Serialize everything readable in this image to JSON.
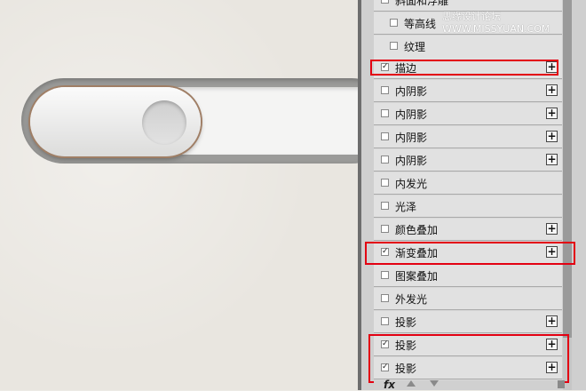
{
  "watermark": "思缘设计论坛 WWW.MISSYUAN.COM",
  "styles": [
    {
      "label": "斜面和浮雕",
      "checked": false,
      "plus": false,
      "indent": false
    },
    {
      "label": "等高线",
      "checked": false,
      "plus": false,
      "indent": true
    },
    {
      "label": "纹理",
      "checked": false,
      "plus": false,
      "indent": true
    },
    {
      "label": "描边",
      "checked": true,
      "plus": true,
      "indent": false
    },
    {
      "label": "内阴影",
      "checked": false,
      "plus": true,
      "indent": false
    },
    {
      "label": "内阴影",
      "checked": false,
      "plus": true,
      "indent": false
    },
    {
      "label": "内阴影",
      "checked": false,
      "plus": true,
      "indent": false
    },
    {
      "label": "内阴影",
      "checked": false,
      "plus": true,
      "indent": false
    },
    {
      "label": "内发光",
      "checked": false,
      "plus": false,
      "indent": false
    },
    {
      "label": "光泽",
      "checked": false,
      "plus": false,
      "indent": false
    },
    {
      "label": "颜色叠加",
      "checked": false,
      "plus": true,
      "indent": false
    },
    {
      "label": "渐变叠加",
      "checked": true,
      "plus": true,
      "indent": false
    },
    {
      "label": "图案叠加",
      "checked": false,
      "plus": false,
      "indent": false
    },
    {
      "label": "外发光",
      "checked": false,
      "plus": false,
      "indent": false
    },
    {
      "label": "投影",
      "checked": false,
      "plus": true,
      "indent": false
    },
    {
      "label": "投影",
      "checked": true,
      "plus": true,
      "indent": false
    },
    {
      "label": "投影",
      "checked": true,
      "plus": true,
      "indent": false
    }
  ],
  "footer": {
    "fx_label": "fx"
  },
  "colors": {
    "highlight": "#e30012"
  }
}
